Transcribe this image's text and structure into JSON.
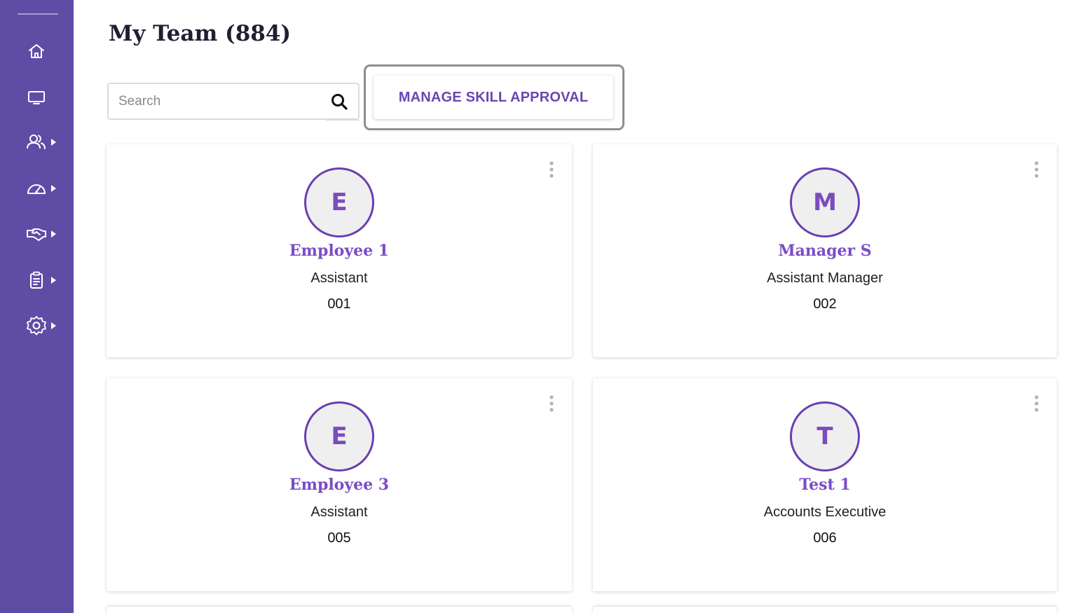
{
  "page": {
    "title": "My Team (884)"
  },
  "search": {
    "placeholder": "Search",
    "value": ""
  },
  "toolbar": {
    "manage_skill_label": "MANAGE SKILL APPROVAL"
  },
  "sidebar": {
    "items": [
      {
        "id": "home",
        "icon": "home-icon",
        "has_submenu": false
      },
      {
        "id": "monitor",
        "icon": "monitor-icon",
        "has_submenu": false
      },
      {
        "id": "team",
        "icon": "users-icon",
        "has_submenu": true
      },
      {
        "id": "dashboard",
        "icon": "gauge-icon",
        "has_submenu": true
      },
      {
        "id": "handshake",
        "icon": "handshake-icon",
        "has_submenu": true
      },
      {
        "id": "clipboard",
        "icon": "clipboard-icon",
        "has_submenu": true
      },
      {
        "id": "settings",
        "icon": "gear-icon",
        "has_submenu": true
      }
    ]
  },
  "team": {
    "members": [
      {
        "initial": "E",
        "name": "Employee 1",
        "role": "Assistant",
        "code": "001"
      },
      {
        "initial": "M",
        "name": "Manager S",
        "role": "Assistant Manager",
        "code": "002"
      },
      {
        "initial": "E",
        "name": "Employee 3",
        "role": "Assistant",
        "code": "005"
      },
      {
        "initial": "T",
        "name": "Test 1",
        "role": "Accounts Executive",
        "code": "006"
      }
    ]
  },
  "colors": {
    "sidebar_bg": "#5f4ca5",
    "accent": "#7b4cc4",
    "avatar_border": "#6a3fb0",
    "button_text": "#6a47b0"
  }
}
